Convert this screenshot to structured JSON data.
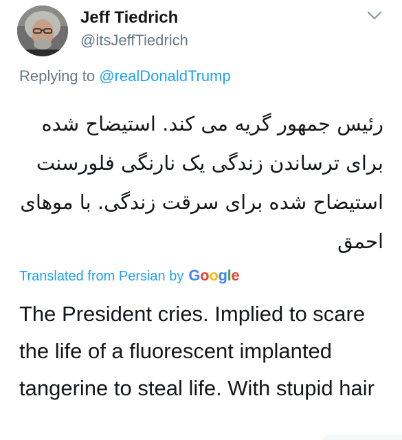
{
  "author": {
    "display_name": "Jeff Tiedrich",
    "handle": "@itsJeffTiedrich",
    "avatar_icon": "profile-photo"
  },
  "reply": {
    "prefix": "Replying to",
    "mention": "@realDonaldTrump"
  },
  "tweet": {
    "lang": "fa",
    "text": "رئیس جمهور گریه می کند. استیضاح شده برای ترساندن زندگی یک نارنگی فلورسنت استیضاح شده برای سرقت زندگی. با موهای احمق"
  },
  "translation": {
    "label": "Translated from Persian by",
    "provider": "Google",
    "provider_colors": [
      "#4285F4",
      "#EA4335",
      "#FBBC05",
      "#4285F4",
      "#34A853",
      "#EA4335"
    ],
    "text": "The President cries. Implied to scare the life of a fluorescent implanted tangerine to steal life. With stupid hair"
  },
  "menu": {
    "icon": "chevron-down-icon"
  },
  "colors": {
    "link": "#1da1f2",
    "secondary_text": "#657786",
    "primary_text": "#14171a"
  }
}
